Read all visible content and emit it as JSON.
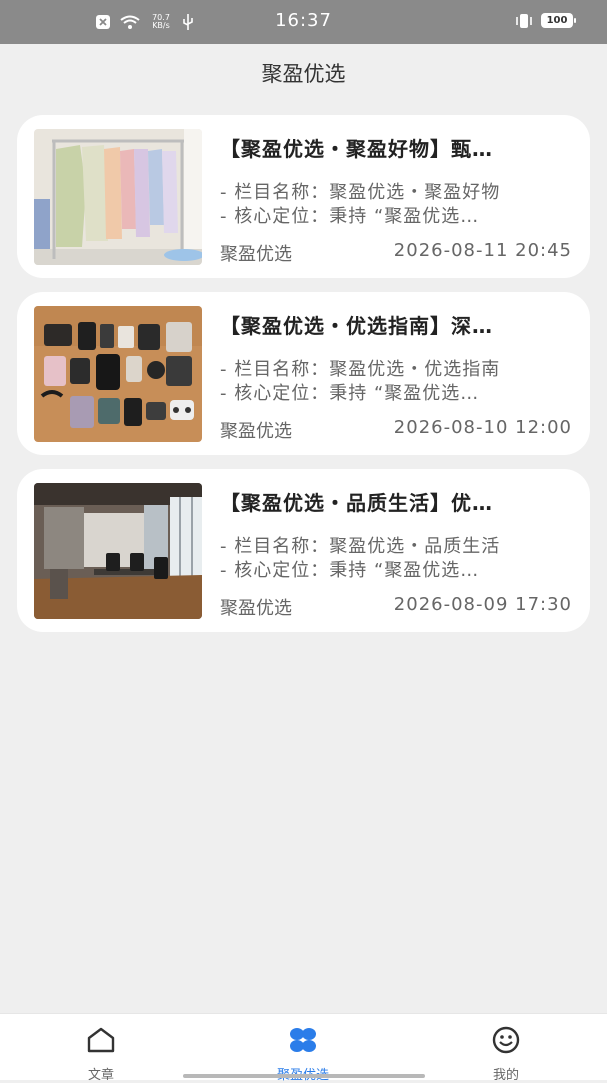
{
  "status_bar": {
    "time": "16:37",
    "net_speed_value": "70.7",
    "net_speed_unit": "KB/s",
    "battery": "100"
  },
  "header": {
    "title": "聚盈优选"
  },
  "articles": [
    {
      "title": "【聚盈优选・聚盈好物】甄…",
      "line1": "- 栏目名称：聚盈优选・聚盈好物",
      "line2": "- 核心定位：秉持 “聚盈优选…",
      "source": "聚盈优选",
      "date": "2026-08-11 20:45"
    },
    {
      "title": "【聚盈优选・优选指南】深…",
      "line1": "- 栏目名称：聚盈优选・优选指南",
      "line2": "- 核心定位：秉持 “聚盈优选…",
      "source": "聚盈优选",
      "date": "2026-08-10 12:00"
    },
    {
      "title": "【聚盈优选・品质生活】优…",
      "line1": "- 栏目名称：聚盈优选・品质生活",
      "line2": "- 核心定位：秉持 “聚盈优选…",
      "source": "聚盈优选",
      "date": "2026-08-09 17:30"
    }
  ],
  "tabbar": {
    "tabs": [
      {
        "label": "文章",
        "icon": "home-icon",
        "active": false
      },
      {
        "label": "聚盈优选",
        "icon": "four-petal-icon",
        "active": true
      },
      {
        "label": "我的",
        "icon": "smiley-icon",
        "active": false
      }
    ]
  },
  "colors": {
    "accent": "#2b7de9",
    "background": "#efefef",
    "status_bar": "#8a8a8a"
  }
}
